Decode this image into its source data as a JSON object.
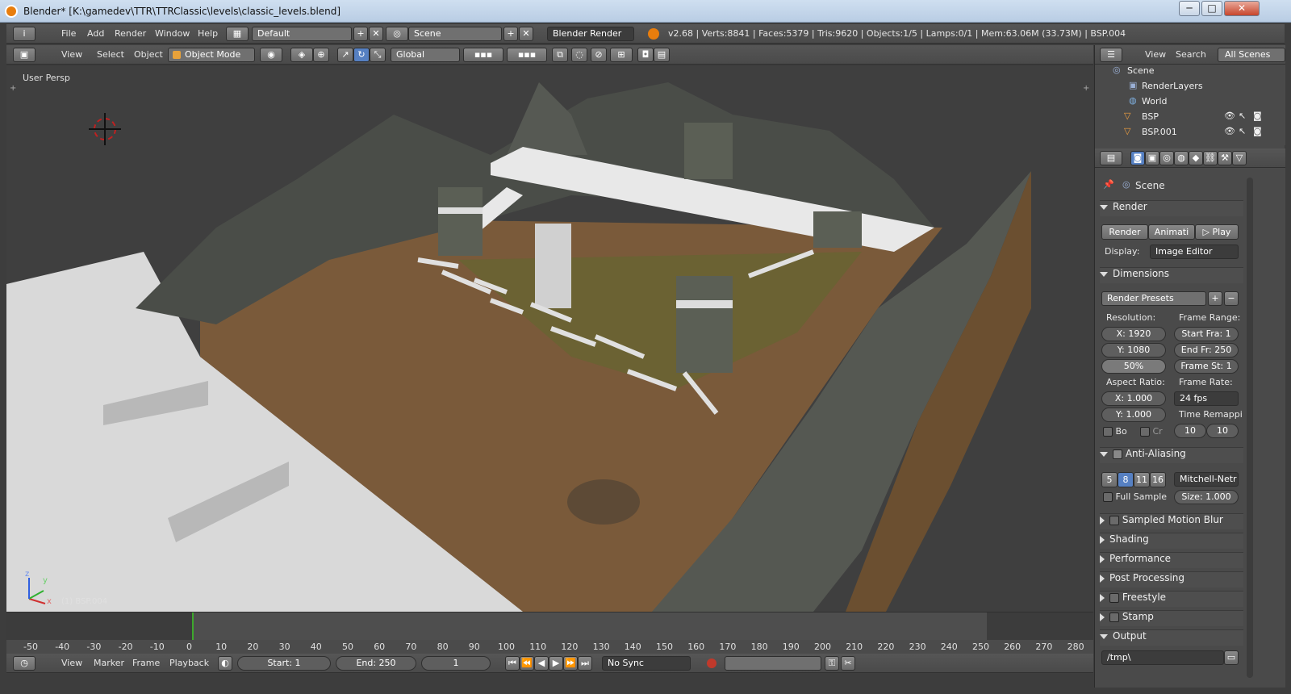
{
  "window": {
    "title": "Blender* [K:\\gamedev\\TTR\\TTRClassic\\levels\\classic_levels.blend]",
    "min_icon": "minimize-icon",
    "max_icon": "maximize-icon",
    "close_icon": "close-icon"
  },
  "info_header": {
    "menus": [
      "File",
      "Add",
      "Render",
      "Window",
      "Help"
    ],
    "layout": "Default",
    "scene": "Scene",
    "engine": "Blender Render",
    "stats": "v2.68 | Verts:8841 | Faces:5379 | Tris:9620 | Objects:1/5 | Lamps:0/1 | Mem:63.06M (33.73M) | BSP.004"
  },
  "view3d_header": {
    "menus": [
      "View",
      "Select",
      "Object"
    ],
    "mode": "Object Mode",
    "orientation": "Global"
  },
  "viewport": {
    "label": "User Persp",
    "object_label": "(1) BSP.004",
    "axis_x": "x",
    "axis_y": "y",
    "axis_z": "z"
  },
  "outliner": {
    "menus": [
      "View",
      "Search"
    ],
    "filter": "All Scenes",
    "items": [
      {
        "label": "Scene",
        "icon": "scene-icon"
      },
      {
        "label": "RenderLayers",
        "icon": "renderlayers-icon"
      },
      {
        "label": "World",
        "icon": "world-icon"
      },
      {
        "label": "BSP",
        "icon": "mesh-icon"
      },
      {
        "label": "BSP.001",
        "icon": "mesh-icon"
      }
    ]
  },
  "properties": {
    "context": "Scene",
    "render": {
      "title": "Render",
      "render_btn": "Render",
      "anim_btn": "Animati",
      "play_btn": "Play",
      "display_label": "Display:",
      "display_value": "Image Editor"
    },
    "dimensions": {
      "title": "Dimensions",
      "presets": "Render Presets",
      "resolution_label": "Resolution:",
      "res_x": "X: 1920",
      "res_y": "Y: 1080",
      "res_pct": "50%",
      "frame_range_label": "Frame Range:",
      "start": "Start Fra: 1",
      "end": "End Fr: 250",
      "step": "Frame St: 1",
      "aspect_label": "Aspect Ratio:",
      "aspect_x": "X: 1.000",
      "aspect_y": "Y: 1.000",
      "frame_rate_label": "Frame Rate:",
      "fps": "24 fps",
      "time_remap_label": "Time Remappi",
      "remap_old": "10",
      "remap_new": "10",
      "border": "Bo",
      "crop": "Cr"
    },
    "anti_aliasing": {
      "title": "Anti-Aliasing",
      "samples": [
        "5",
        "8",
        "11",
        "16"
      ],
      "filter": "Mitchell-Netr",
      "full_sample": "Full Sample",
      "size": "Size: 1.000"
    },
    "collapsed_panels": [
      "Sampled Motion Blur",
      "Shading",
      "Performance",
      "Post Processing",
      "Freestyle",
      "Stamp"
    ],
    "output": {
      "title": "Output",
      "path": "/tmp\\"
    }
  },
  "timeline": {
    "ticks": [
      "-50",
      "-40",
      "-30",
      "-20",
      "-10",
      "0",
      "10",
      "20",
      "30",
      "40",
      "50",
      "60",
      "70",
      "80",
      "90",
      "100",
      "110",
      "120",
      "130",
      "140",
      "150",
      "160",
      "170",
      "180",
      "190",
      "200",
      "210",
      "220",
      "230",
      "240",
      "250",
      "260",
      "270",
      "280"
    ],
    "menus": [
      "View",
      "Marker",
      "Frame",
      "Playback"
    ],
    "start": "Start: 1",
    "end": "End: 250",
    "current": "1",
    "sync": "No Sync"
  },
  "colors": {
    "accent": "#5680c2",
    "record": "#c0392b",
    "playhead": "#3ea72d",
    "terrain": "#7a5a3a"
  }
}
